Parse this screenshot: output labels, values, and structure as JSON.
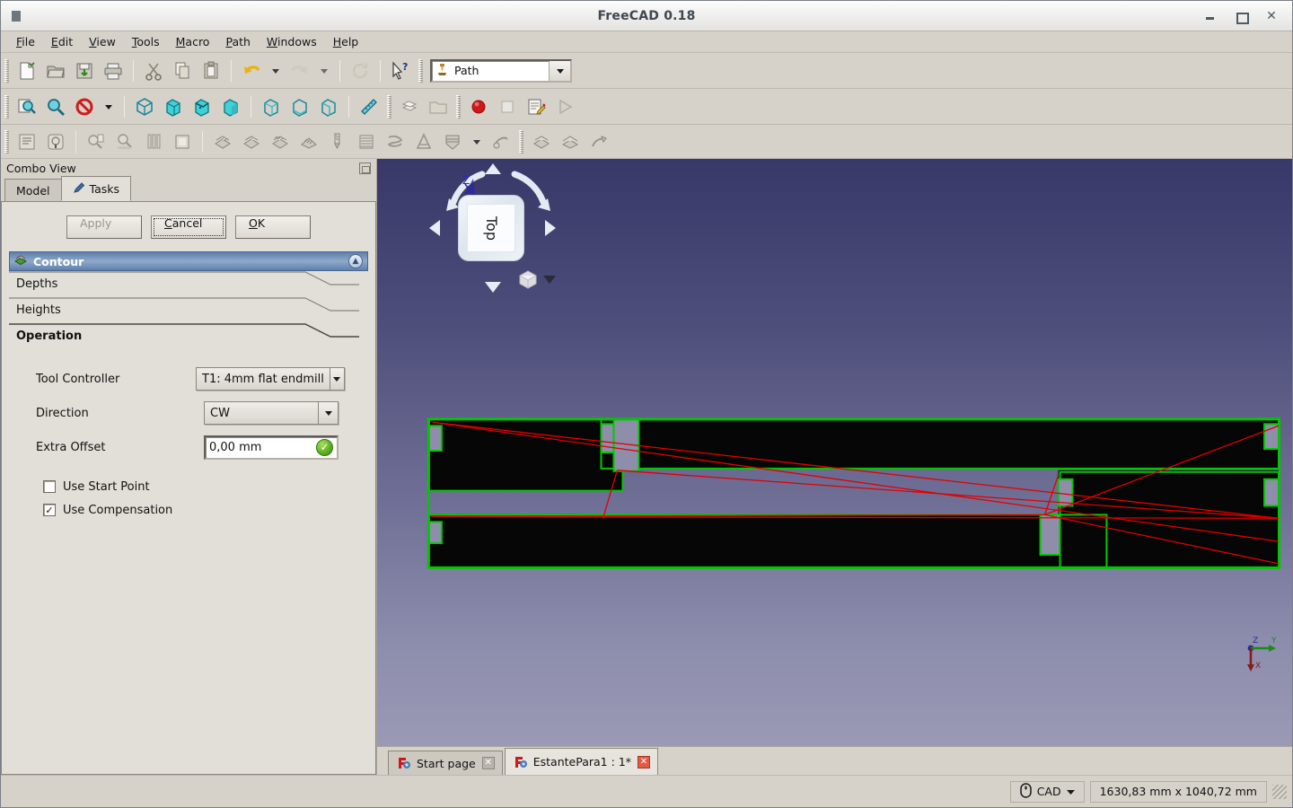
{
  "window": {
    "title": "FreeCAD 0.18",
    "app_icon": "freecad-icon",
    "minimize": "minimize-icon",
    "maximize": "maximize-icon",
    "close": "close-icon"
  },
  "menubar": {
    "items": [
      {
        "label": "File",
        "mnemonic": "F"
      },
      {
        "label": "Edit",
        "mnemonic": "E"
      },
      {
        "label": "View",
        "mnemonic": "V"
      },
      {
        "label": "Tools",
        "mnemonic": "T"
      },
      {
        "label": "Macro",
        "mnemonic": "M"
      },
      {
        "label": "Path",
        "mnemonic": "P"
      },
      {
        "label": "Windows",
        "mnemonic": "W"
      },
      {
        "label": "Help",
        "mnemonic": "H"
      }
    ]
  },
  "workbench": {
    "label": "Path",
    "icon": "path-workbench-icon"
  },
  "toolbars": {
    "file_edit": [
      "new-document-icon",
      "open-document-icon",
      "save-document-icon",
      "print-icon",
      "cut-icon",
      "copy-icon",
      "paste-icon",
      "undo-icon",
      "undo-dropdown-icon",
      "redo-icon",
      "redo-dropdown-icon",
      "refresh-icon",
      "whats-this-icon"
    ],
    "view": [
      "fit-all-icon",
      "zoom-box-icon",
      "draw-style-icon",
      "draw-style-dropdown-icon",
      "isometric-view-icon",
      "front-view-icon",
      "top-view-icon",
      "right-view-icon",
      "rear-view-icon",
      "bottom-view-icon",
      "left-view-icon",
      "measure-icon"
    ],
    "view2": [
      "std-views-icon",
      "folder-icon",
      "record-macro-icon",
      "stop-macro-icon",
      "edit-macro-icon",
      "execute-macro-icon"
    ],
    "path": [
      "path-job-icon",
      "path-post-process-icon",
      "path-inspect-icon",
      "path-simulator-icon",
      "path-toolbit-library-icon",
      "path-sanity-icon",
      "path-profile-icon",
      "path-pocket-icon",
      "path-contour-icon",
      "path-face-icon",
      "path-drilling-icon",
      "path-surface-icon",
      "path-helix-icon",
      "path-adaptive-icon",
      "path-engrave-icon",
      "path-engrave-dropdown-icon",
      "path-deburr-icon",
      "path-array-icon",
      "path-copy-icon",
      "path-dressup-icon"
    ]
  },
  "combo_view": {
    "title": "Combo View",
    "float_button": "float-dock-icon",
    "tabs": [
      {
        "label": "Model",
        "active": false,
        "icon": ""
      },
      {
        "label": "Tasks",
        "active": true,
        "icon": "pencil-icon"
      }
    ],
    "buttons": {
      "apply": "Apply",
      "apply_enabled": false,
      "cancel": "Cancel",
      "cancel_mnemonic": "C",
      "ok": "OK",
      "ok_mnemonic": "O"
    },
    "task_panel": {
      "title": "Contour",
      "icon": "path-contour-icon",
      "collapse_icon": "chevron-double-up-icon",
      "groups": [
        {
          "label": "Depths",
          "expanded": false,
          "bold": false
        },
        {
          "label": "Heights",
          "expanded": false,
          "bold": false
        },
        {
          "label": "Operation",
          "expanded": true,
          "bold": true
        }
      ],
      "fields": {
        "tool_controller": {
          "label": "Tool Controller",
          "value": "T1: 4mm flat endmill",
          "type": "combobox"
        },
        "direction": {
          "label": "Direction",
          "value": "CW",
          "type": "combobox"
        },
        "extra_offset": {
          "label": "Extra Offset",
          "value": "0,00 mm",
          "type": "quantity",
          "validation_icon": "valid-check-icon",
          "validation_color": "#62b023"
        }
      },
      "checkboxes": [
        {
          "label": "Use Start Point",
          "checked": false
        },
        {
          "label": "Use Compensation",
          "checked": true
        }
      ]
    }
  },
  "view3d": {
    "nav_cube": {
      "face_label": "Top",
      "up_arrow": "nav-up-arrow-icon",
      "down_arrow": "nav-down-arrow-icon",
      "left_arrow": "nav-left-arrow-icon",
      "right_arrow": "nav-right-arrow-icon",
      "rotate_ccw": "rotate-ccw-icon",
      "rotate_cw": "rotate-cw-icon",
      "z_axis_label": "Z"
    },
    "iso_button": {
      "icon": "isometric-cube-icon",
      "dropdown": "view-dropdown-icon"
    },
    "axis_indicator": {
      "x_label": "X",
      "y_label": "Y",
      "z_label": "Z",
      "x_color": "#8b1a1a",
      "y_color": "#1a8b1a",
      "z_color": "#2a2a8b"
    },
    "colors": {
      "background_top": "#383869",
      "background_bottom": "#9a9ab6",
      "part_fill": "#060606",
      "toolpath": "#00c800",
      "rapid_move": "#e00000"
    }
  },
  "mdi_tabs": [
    {
      "label": "Start page",
      "active": false,
      "icon": "freecad-icon",
      "close": "close-tab-icon"
    },
    {
      "label": "EstantePara1 : 1*",
      "active": true,
      "icon": "freecad-icon",
      "close": "close-tab-icon"
    }
  ],
  "statusbar": {
    "nav_style": {
      "label": "CAD",
      "icon": "mouse-icon",
      "dropdown": "chevron-down-icon"
    },
    "dimensions": "1630,83 mm x 1040,72 mm",
    "resize_grip": "resize-grip-icon"
  }
}
